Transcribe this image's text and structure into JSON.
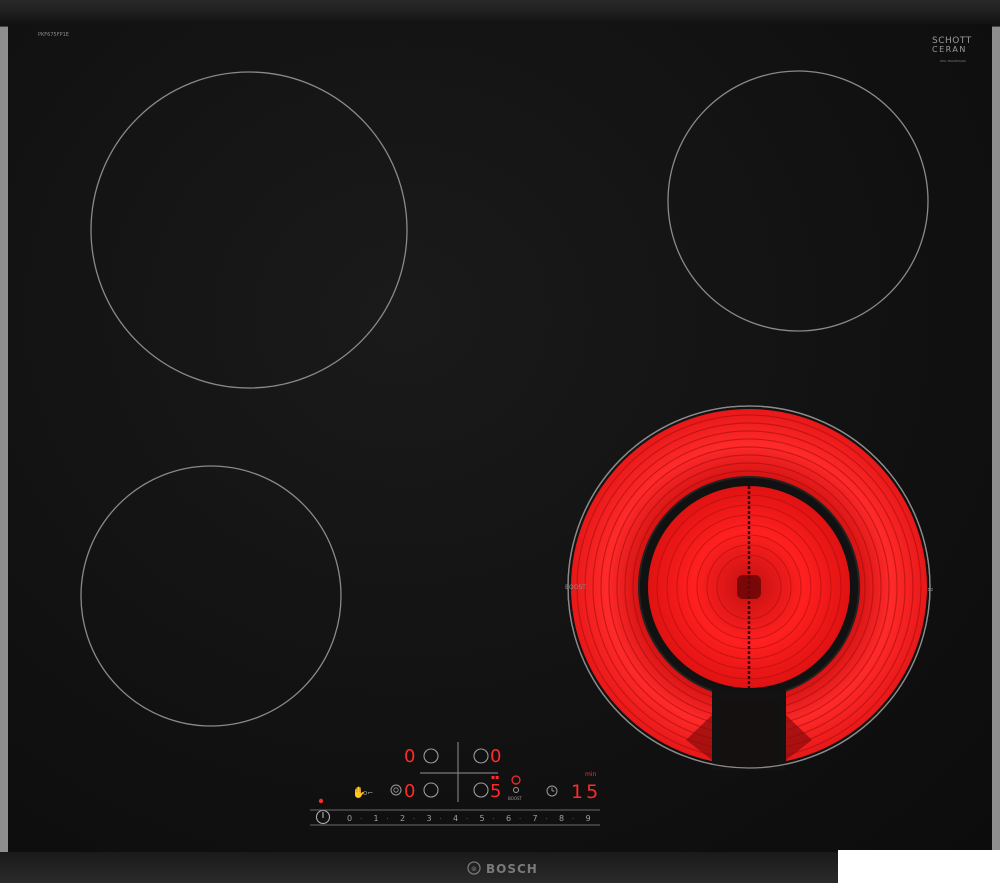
{
  "hob": {
    "model_code": "PKF675FP1E",
    "glass_brand_line1": "SCHOTT",
    "glass_brand_line2": "CERAN",
    "glass_brand_sub": "REG.TRADEMARK",
    "brand": "BOSCH"
  },
  "zones": {
    "front_right_label": "BOOST"
  },
  "controls": {
    "display_rear_left": "0",
    "display_rear_right": "0",
    "display_front_left": "0",
    "display_front_right": "5",
    "boost_label": "BOOST",
    "timer_unit": "min",
    "timer_value": "15",
    "slider_scale": [
      "0",
      "1",
      "2",
      "3",
      "4",
      "5",
      "6",
      "7",
      "8",
      "9"
    ]
  },
  "colors": {
    "glass": "#111111",
    "zone_outline": "#8a8a8a",
    "heat_red": "#ff1a1a",
    "display_red": "#ff2a2a"
  },
  "icons": [
    "childlock-icon",
    "power-icon",
    "timer-icon",
    "keep-warm-icon"
  ]
}
